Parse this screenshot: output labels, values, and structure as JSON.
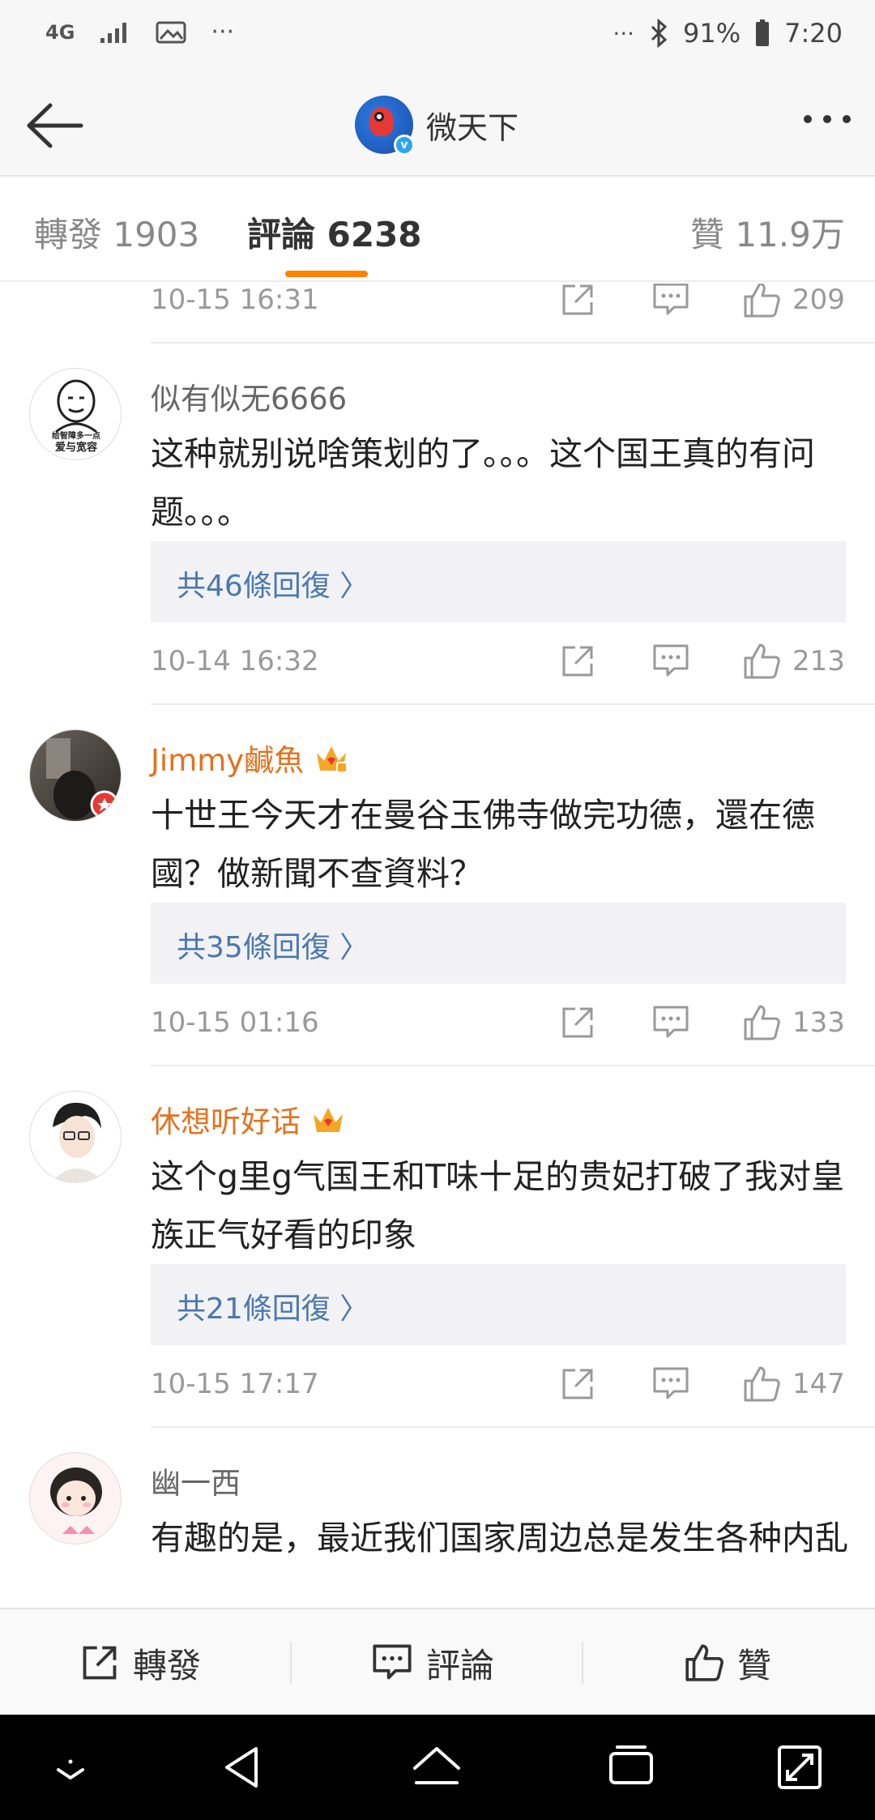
{
  "status_bar": {
    "network": "4G",
    "battery": "91%",
    "time": "7:20",
    "left_dots": "···",
    "right_dots": "···"
  },
  "header": {
    "title": "微天下"
  },
  "tabs": [
    {
      "label": "轉發 1903",
      "active": false
    },
    {
      "label": "評論 6238",
      "active": true
    },
    {
      "label": "贊 11.9万",
      "active": false
    }
  ],
  "top_partial": {
    "time": "10-15 16:31",
    "likes": "209"
  },
  "comments": [
    {
      "user": "似有似无6666",
      "vip": false,
      "text": "这种就别说啥策划的了。。。这个国王真的有问题。。。",
      "replies": "共46條回復 〉",
      "time": "10-14 16:32",
      "likes": "213",
      "avatar_text": "给智障多一点 爱与宽容"
    },
    {
      "user": "Jimmy鹹魚",
      "vip": true,
      "text": "十世王今天才在曼谷玉佛寺做完功德，還在德國？做新聞不查資料？",
      "replies": "共35條回復 〉",
      "time": "10-15 01:16",
      "likes": "133"
    },
    {
      "user": "休想听好话",
      "vip": true,
      "text": "这个g里g气国王和T味十足的贵妃打破了我对皇族正气好看的印象",
      "replies": "共21條回復 〉",
      "time": "10-15 17:17",
      "likes": "147"
    },
    {
      "user": "幽一西",
      "vip": false,
      "text": "有趣的是，最近我们国家周边总是发生各种内乱"
    }
  ],
  "bottom_bar": {
    "share": "轉發",
    "comment": "評論",
    "like": "贊"
  },
  "colors": {
    "accent": "#ff8200",
    "vip_name": "#e5711e",
    "reply_link": "#4a78b0",
    "crown": "#f5a623"
  }
}
